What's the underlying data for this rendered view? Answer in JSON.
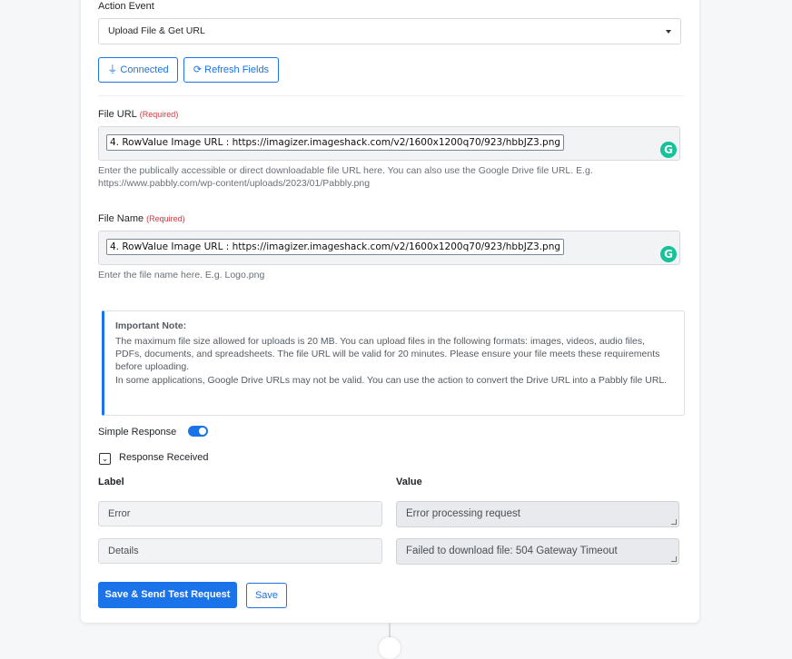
{
  "action_event": {
    "label": "Action Event",
    "value": "Upload File & Get URL"
  },
  "buttons": {
    "connected": "Connected",
    "refresh_fields": "Refresh Fields",
    "connected_icon": "plug-icon",
    "refresh_icon": "refresh-icon"
  },
  "file_url": {
    "label": "File URL",
    "required": "(Required)",
    "value": "4. RowValue Image URL : https://imagizer.imageshack.com/v2/1600x1200q70/923/hbbJZ3.png",
    "help": "Enter the publically accessible or direct downloadable file URL here. You can also use the Google Drive file URL. E.g. https://www.pabbly.com/wp-content/uploads/2023/01/Pabbly.png"
  },
  "file_name": {
    "label": "File Name",
    "required": "(Required)",
    "value": "4. RowValue Image URL : https://imagizer.imageshack.com/v2/1600x1200q70/923/hbbJZ3.png",
    "help": "Enter the file name here. E.g. Logo.png"
  },
  "grammarly_glyph": "G",
  "note": {
    "title": "Important Note:",
    "text1": "The maximum file size allowed for uploads is 20 MB. You can upload files in the following formats: images, videos, audio files, PDFs, documents, and spreadsheets. The file URL will be valid for 20 minutes. Please ensure your file meets these requirements before uploading.",
    "text2": "In some applications, Google Drive URLs may not be valid. You can use the action to convert the Drive URL into a Pabbly file URL."
  },
  "simple_response": {
    "label": "Simple Response",
    "enabled": true
  },
  "response_received": {
    "label": "Response Received",
    "columns": {
      "label": "Label",
      "value": "Value"
    },
    "rows": [
      {
        "label": "Error",
        "value": "Error processing request"
      },
      {
        "label": "Details",
        "value": "Failed to download file: 504 Gateway Timeout"
      }
    ]
  },
  "actions": {
    "save_send": "Save & Send Test Request",
    "save": "Save"
  },
  "colors": {
    "accent": "#1a73e8",
    "required": "#d9363e",
    "grammarly": "#15c39a"
  }
}
